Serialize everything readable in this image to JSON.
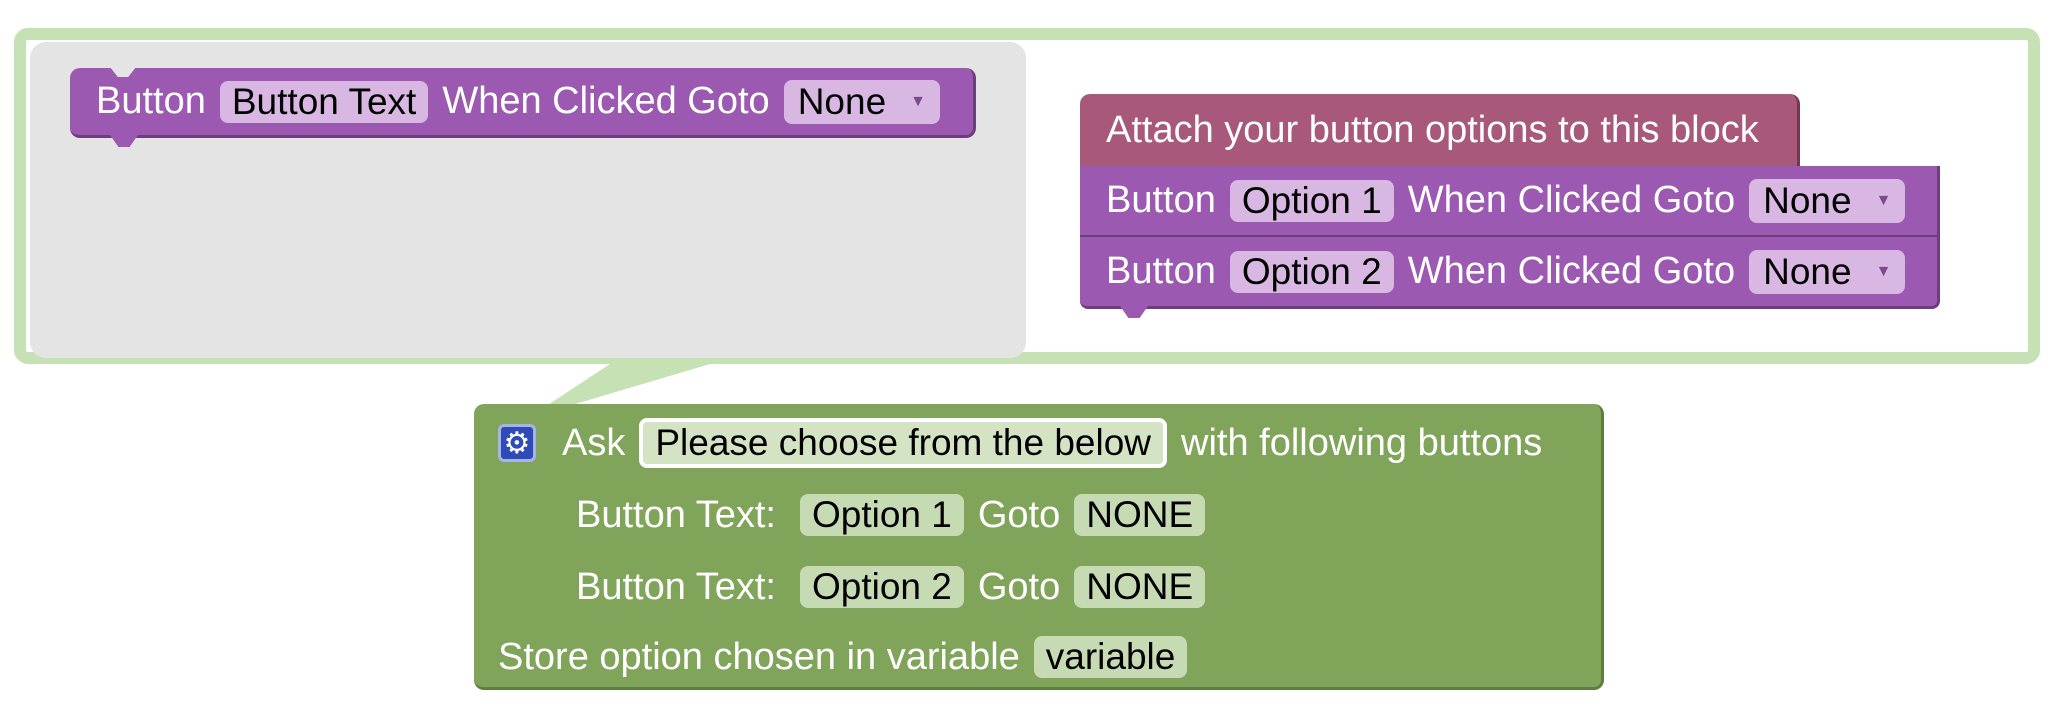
{
  "flyout": {
    "button_block": {
      "label": "Button",
      "text_field": "Button Text",
      "goto_label": "When Clicked Goto",
      "goto_value": "None"
    }
  },
  "mutator": {
    "container_label": "Attach your button options to this block",
    "options": [
      {
        "label": "Button",
        "text_field": "Option 1",
        "goto_label": "When Clicked Goto",
        "goto_value": "None"
      },
      {
        "label": "Button",
        "text_field": "Option 2",
        "goto_label": "When Clicked Goto",
        "goto_value": "None"
      }
    ]
  },
  "ask_block": {
    "ask_label": "Ask",
    "question": "Please choose from the below",
    "suffix": "with following buttons",
    "buttons": [
      {
        "label": "Button Text:",
        "text": "Option 1",
        "goto_label": "Goto",
        "goto_value": "NONE"
      },
      {
        "label": "Button Text:",
        "text": "Option 2",
        "goto_label": "Goto",
        "goto_value": "NONE"
      }
    ],
    "store_label": "Store option chosen in variable",
    "variable": "variable"
  },
  "colors": {
    "purple_block": "#9c59b2",
    "rose_block": "#a8587b",
    "green_block": "#80a55a",
    "mutator_border": "#c6e1b3",
    "gear_icon": "#2f4bb8"
  },
  "icons": [
    "gear-icon",
    "dropdown-arrow-icon"
  ]
}
